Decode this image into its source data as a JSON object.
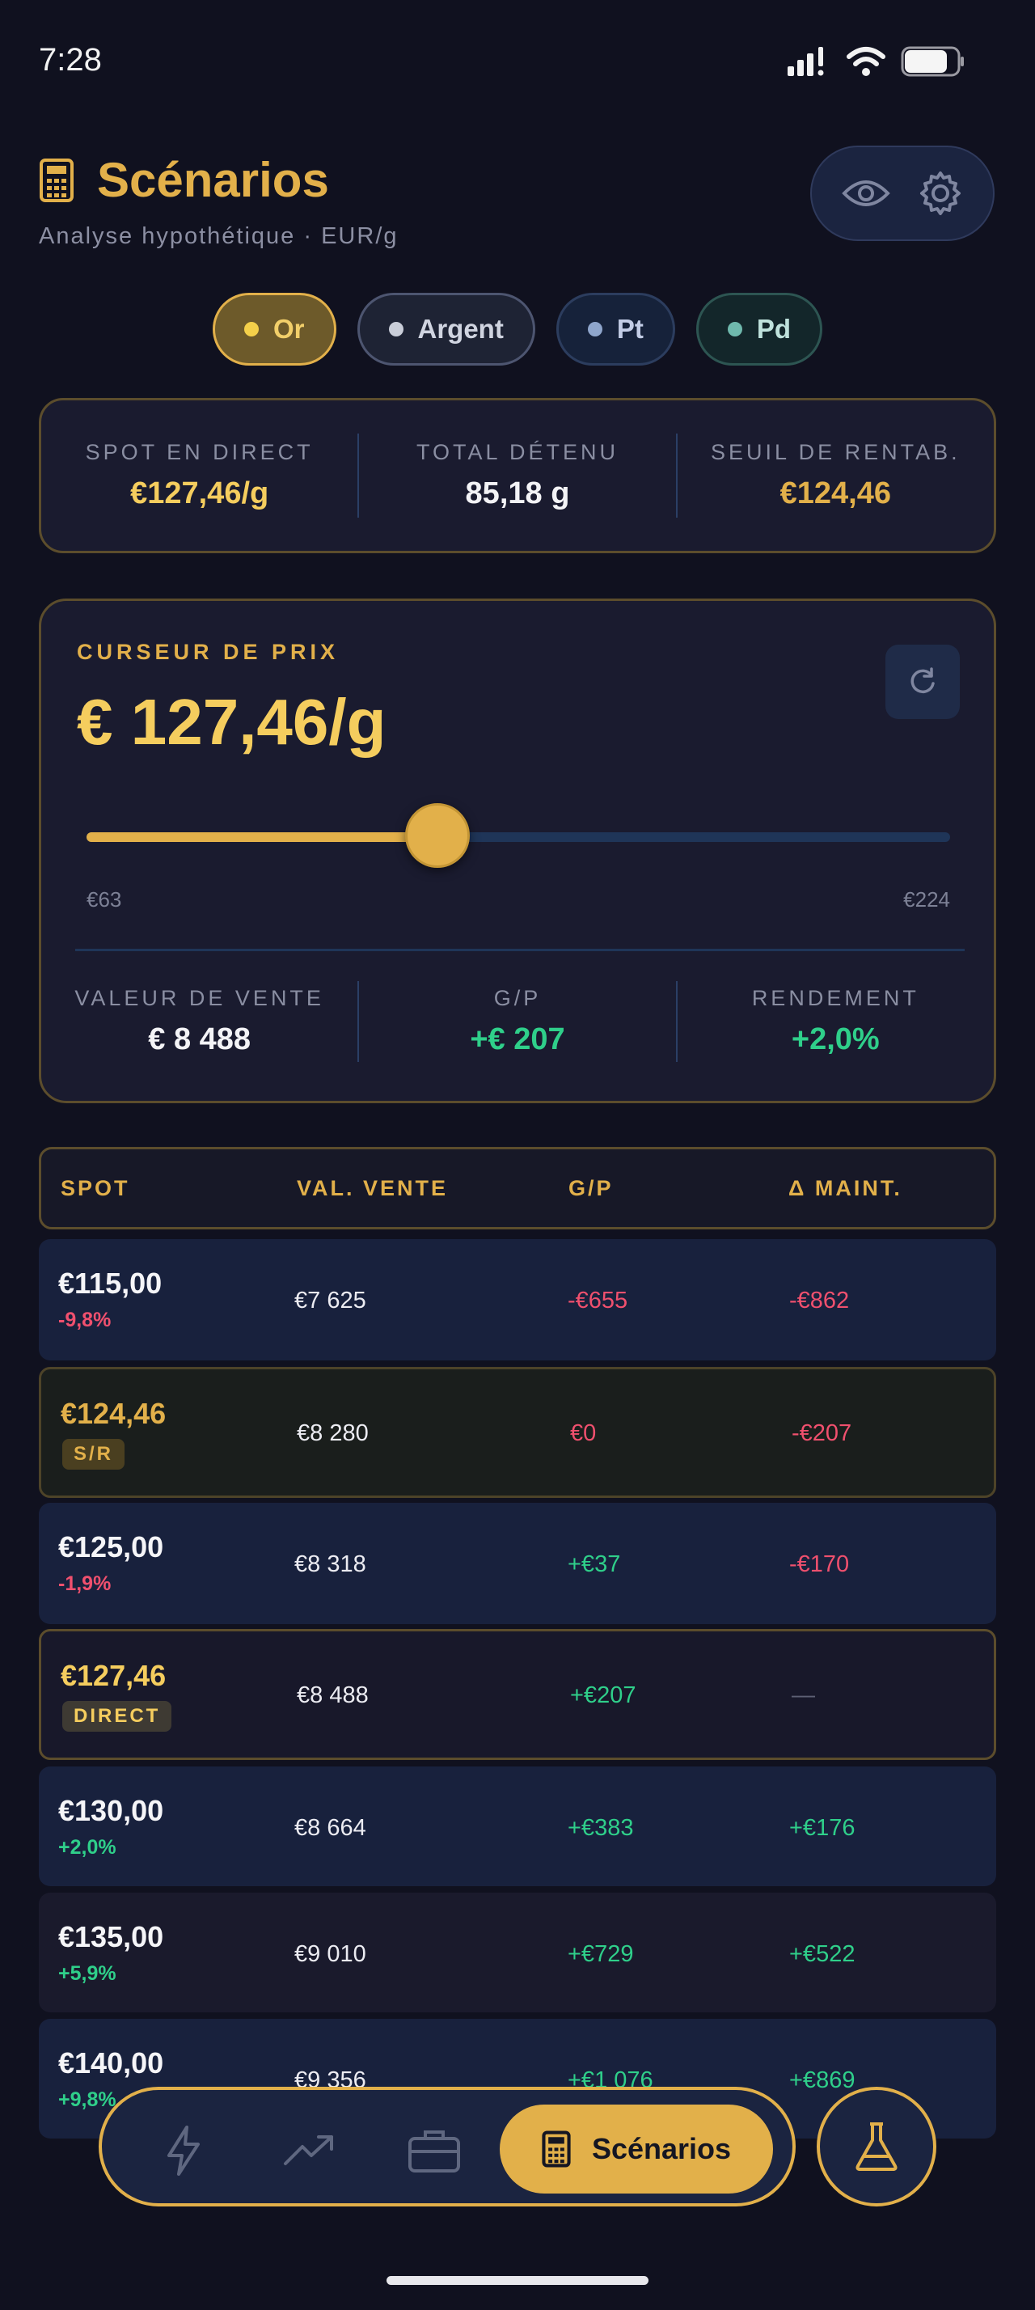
{
  "status": {
    "time": "7:28"
  },
  "header": {
    "title": "Scénarios",
    "subtitle": "Analyse hypothétique  ·  EUR/g"
  },
  "metals": [
    {
      "label": "Or",
      "selected": true,
      "color": "#f4d04a"
    },
    {
      "label": "Argent",
      "selected": false,
      "color": "#c9cdd8"
    },
    {
      "label": "Pt",
      "selected": false,
      "color": "#8fa6cc"
    },
    {
      "label": "Pd",
      "selected": false,
      "color": "#6fb9ad"
    }
  ],
  "summary": [
    {
      "label": "SPOT EN DIRECT",
      "value": "€127,46/g"
    },
    {
      "label": "TOTAL DÉTENU",
      "value": "85,18 g"
    },
    {
      "label": "SEUIL DE RENTAB.",
      "value": "€124,46"
    }
  ],
  "slider": {
    "label": "CURSEUR DE PRIX",
    "price": "€ 127,46/g",
    "min": "€63",
    "max": "€224",
    "min_value": 63,
    "max_value": 224,
    "current_value": 127.46,
    "stats": [
      {
        "label": "VALEUR DE VENTE",
        "value": "€ 8 488"
      },
      {
        "label": "G/P",
        "value": "+€ 207"
      },
      {
        "label": "RENDEMENT",
        "value": "+2,0%"
      }
    ]
  },
  "table": {
    "headers": [
      "SPOT",
      "VAL. VENTE",
      "G/P",
      "Δ MAINT."
    ],
    "rows": [
      {
        "spot": "€115,00",
        "pct": "-9,8%",
        "sale": "€7 625",
        "pl": "-€655",
        "delta": "-€862"
      },
      {
        "spot": "€124,46",
        "badge": "S/R",
        "sale": "€8 280",
        "pl": "€0",
        "delta": "-€207"
      },
      {
        "spot": "€125,00",
        "pct": "-1,9%",
        "sale": "€8 318",
        "pl": "+€37",
        "delta": "-€170"
      },
      {
        "spot": "€127,46",
        "badge": "DIRECT",
        "sale": "€8 488",
        "pl": "+€207",
        "delta": "—"
      },
      {
        "spot": "€130,00",
        "pct": "+2,0%",
        "sale": "€8 664",
        "pl": "+€383",
        "delta": "+€176"
      },
      {
        "spot": "€135,00",
        "pct": "+5,9%",
        "sale": "€9 010",
        "pl": "+€729",
        "delta": "+€522"
      },
      {
        "spot": "€140,00",
        "pct": "+9,8%",
        "sale": "€9 356",
        "pl": "+€1 076",
        "delta": "+€869"
      }
    ]
  },
  "nav": {
    "items": [
      "lightning-icon",
      "trend-icon",
      "briefcase-icon"
    ],
    "active_label": "Scénarios"
  },
  "colors": {
    "accent": "#e2b04a",
    "positive": "#2fcf8a",
    "negative": "#f0506e"
  }
}
